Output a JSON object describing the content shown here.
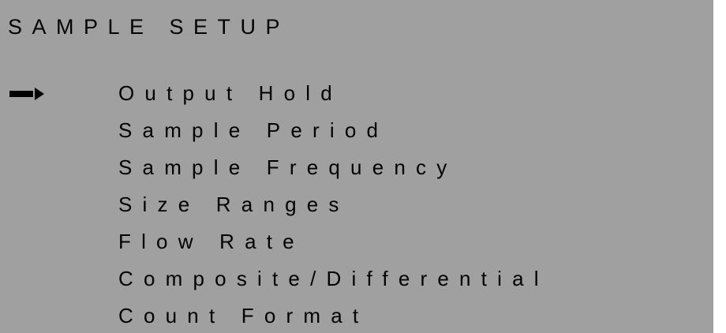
{
  "screen": {
    "title": "SAMPLE SETUP",
    "background_color": "#a0a0a0",
    "text_color": "#000000",
    "selected_index": 0,
    "cursor_icon": "arrow-right-icon",
    "menu_items": [
      "Output Hold",
      "Sample Period",
      "Sample Frequency",
      "Size Ranges",
      "Flow Rate",
      "Composite/Differential",
      "Count Format"
    ]
  }
}
